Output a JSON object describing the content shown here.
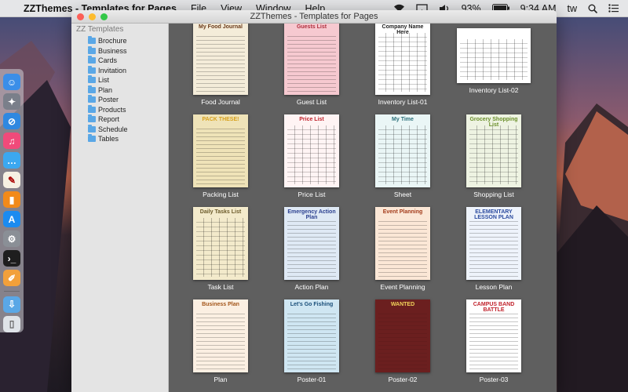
{
  "menubar": {
    "app_name": "ZZThemes - Templates for Pages",
    "menus": [
      "File",
      "View",
      "Window",
      "Help"
    ],
    "battery": "93%",
    "time": "9:34 AM",
    "user": "tw"
  },
  "window": {
    "title": "ZZThemes - Templates for Pages"
  },
  "sidebar": {
    "header": "ZZ Templates",
    "items": [
      "Brochure",
      "Business",
      "Cards",
      "Invitation",
      "List",
      "Plan",
      "Poster",
      "Products",
      "Report",
      "Schedule",
      "Tables"
    ]
  },
  "templates": [
    {
      "label": "Food Journal",
      "thumb_title": "My Food Journal",
      "bg": "#f4ecd9",
      "accent": "#6b3a1a"
    },
    {
      "label": "Guest List",
      "thumb_title": "Guests List",
      "bg": "#f6c9d0",
      "accent": "#b0303f"
    },
    {
      "label": "Inventory List-01",
      "thumb_title": "Company Name Here",
      "bg": "#ffffff",
      "accent": "#222222"
    },
    {
      "label": "Inventory List-02",
      "thumb_title": "",
      "bg": "#ffffff",
      "accent": "#e07a2a"
    },
    {
      "label": "Packing List",
      "thumb_title": "PACK THESE!",
      "bg": "#efe3b8",
      "accent": "#d8a11c"
    },
    {
      "label": "Price List",
      "thumb_title": "Price List",
      "bg": "#fff4f4",
      "accent": "#c0222b"
    },
    {
      "label": "Sheet",
      "thumb_title": "My Time",
      "bg": "#eaf6f6",
      "accent": "#2a6f7a"
    },
    {
      "label": "Shopping List",
      "thumb_title": "Grocery Shopping List",
      "bg": "#eef3e2",
      "accent": "#6a8f2a"
    },
    {
      "label": "Task List",
      "thumb_title": "Daily Tasks List",
      "bg": "#f3eacb",
      "accent": "#6b5a2a"
    },
    {
      "label": "Action Plan",
      "thumb_title": "Emergency Action Plan",
      "bg": "#dfe9f5",
      "accent": "#2a3f8f"
    },
    {
      "label": "Event Planning",
      "thumb_title": "Event Planning",
      "bg": "#fbe7d6",
      "accent": "#a33b1a"
    },
    {
      "label": "Lesson Plan",
      "thumb_title": "ELEMENTARY LESSON PLAN",
      "bg": "#eef3fb",
      "accent": "#2a4a9f"
    },
    {
      "label": "Plan",
      "thumb_title": "Business Plan",
      "bg": "#fbefe2",
      "accent": "#a3561a"
    },
    {
      "label": "Poster-01",
      "thumb_title": "Let's Go Fishing",
      "bg": "#cfe6f2",
      "accent": "#1a4f7a"
    },
    {
      "label": "Poster-02",
      "thumb_title": "WANTED",
      "bg": "#6b1f1f",
      "accent": "#f2d35a"
    },
    {
      "label": "Poster-03",
      "thumb_title": "CAMPUS BAND BATTLE",
      "bg": "#ffffff",
      "accent": "#c0222b"
    }
  ],
  "colors": {
    "traffic_close": "#fc5f57",
    "traffic_min": "#fdbc2e",
    "traffic_max": "#33c748",
    "folder": "#5aa7e6"
  }
}
